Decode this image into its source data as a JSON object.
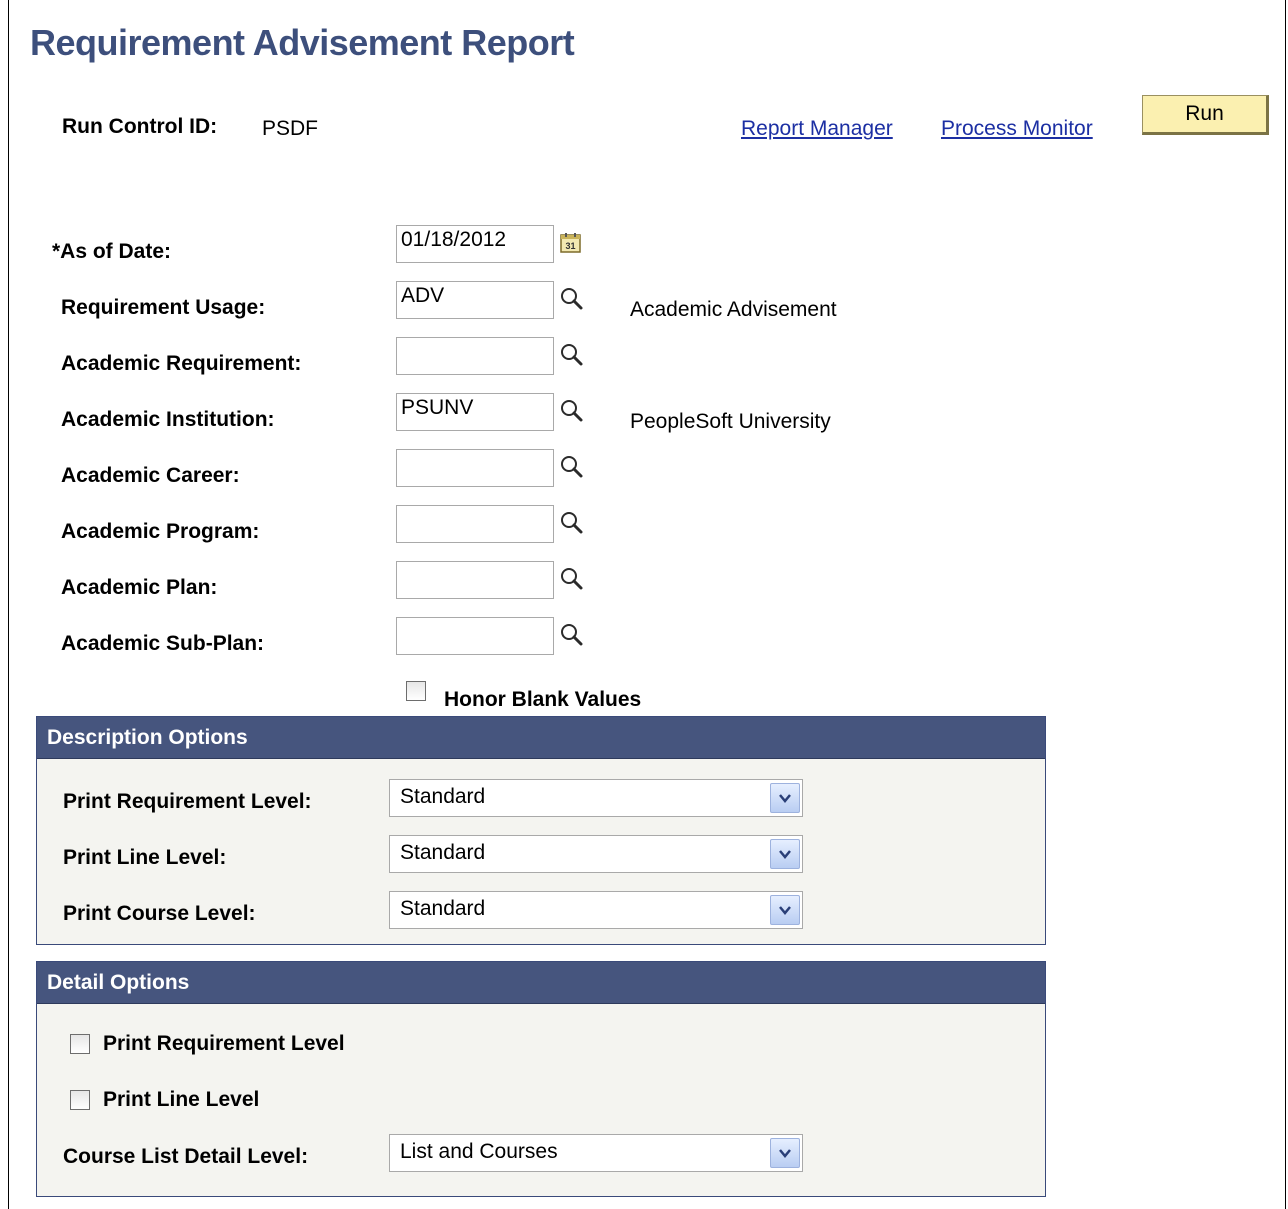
{
  "page": {
    "title": "Requirement Advisement Report"
  },
  "run_control": {
    "label": "Run Control ID:",
    "value": "PSDF"
  },
  "links": {
    "report_manager": "Report Manager",
    "process_monitor": "Process Monitor"
  },
  "run_button": {
    "label": "Run"
  },
  "fields": {
    "as_of_date": {
      "label": "*As of Date:",
      "value": "01/18/2012"
    },
    "requirement_usage": {
      "label": "Requirement Usage:",
      "value": "ADV",
      "description": "Academic Advisement"
    },
    "academic_requirement": {
      "label": "Academic Requirement:",
      "value": ""
    },
    "academic_institution": {
      "label": "Academic Institution:",
      "value": "PSUNV",
      "description": "PeopleSoft University"
    },
    "academic_career": {
      "label": "Academic Career:",
      "value": ""
    },
    "academic_program": {
      "label": "Academic Program:",
      "value": ""
    },
    "academic_plan": {
      "label": "Academic Plan:",
      "value": ""
    },
    "academic_sub_plan": {
      "label": "Academic Sub-Plan:",
      "value": ""
    }
  },
  "honor_blank_values": {
    "label": "Honor Blank Values",
    "checked": false
  },
  "description_options": {
    "title": "Description Options",
    "print_requirement_level": {
      "label": "Print Requirement Level:",
      "value": "Standard"
    },
    "print_line_level": {
      "label": "Print Line Level:",
      "value": "Standard"
    },
    "print_course_level": {
      "label": "Print Course Level:",
      "value": "Standard"
    }
  },
  "detail_options": {
    "title": "Detail Options",
    "print_requirement_level": {
      "label": "Print Requirement Level",
      "checked": false
    },
    "print_line_level": {
      "label": "Print Line Level",
      "checked": false
    },
    "course_list_detail_level": {
      "label": "Course List Detail Level:",
      "value": "List and Courses"
    }
  },
  "colors": {
    "title": "#3d4f7c",
    "link": "#1c2fa3",
    "section_header": "#46557e",
    "run_button": "#fbf0b0"
  },
  "icons": {
    "lookup": "magnifier-icon",
    "calendar": "calendar-icon",
    "dropdown": "chevron-down-icon"
  }
}
